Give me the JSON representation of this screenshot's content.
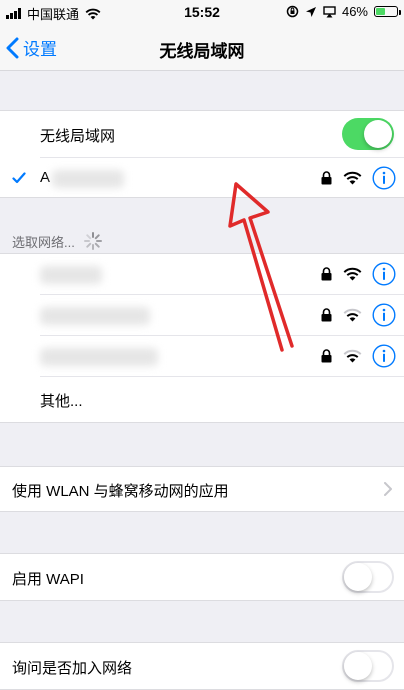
{
  "status_bar": {
    "carrier": "中国联通",
    "time": "15:52",
    "battery": "46%",
    "battery_level": 0.46
  },
  "nav": {
    "back_label": "设置",
    "title": "无线局域网"
  },
  "wifi_toggle": {
    "label": "无线局域网",
    "state": "on"
  },
  "connected_network": {
    "visible_prefix": "A"
  },
  "choose_network": {
    "header": "选取网络..."
  },
  "networks": [
    {
      "secured": true,
      "signal": "full"
    },
    {
      "secured": true,
      "signal": "medium"
    },
    {
      "secured": true,
      "signal": "medium"
    }
  ],
  "other_network_label": "其他...",
  "settings": {
    "wlan_apps_label": "使用 WLAN 与蜂窝移动网的应用",
    "wapi_label": "启用 WAPI",
    "wapi_state": "off",
    "ask_join_label": "询问是否加入网络",
    "ask_join_state": "off"
  },
  "colors": {
    "accent": "#007aff",
    "toggle_on": "#4cd964",
    "annotation_arrow": "#e02a2a"
  },
  "icons": {
    "back": "chevron-left-icon",
    "checkmark": "checkmark-icon",
    "lock": "lock-icon",
    "wifi": "wifi-icon",
    "info": "info-icon",
    "disclosure": "chevron-right-icon",
    "loading": "spinner-icon"
  }
}
